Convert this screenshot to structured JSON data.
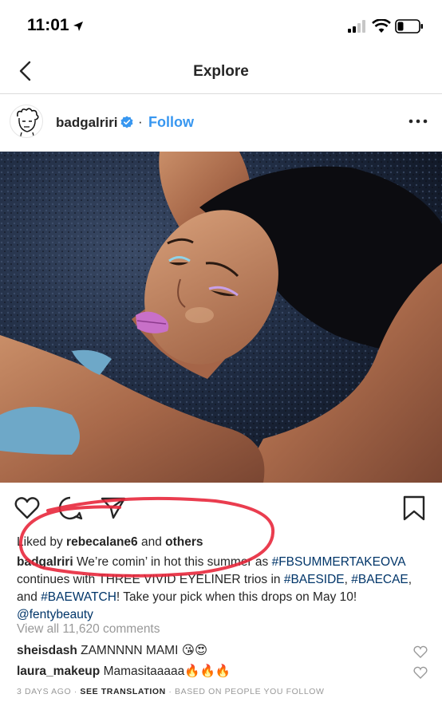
{
  "status_bar": {
    "time": "11:01",
    "icons": [
      "location-arrow-icon",
      "signal-icon",
      "wifi-icon",
      "battery-icon"
    ]
  },
  "nav": {
    "title": "Explore",
    "back_icon": "chevron-left-icon"
  },
  "post": {
    "username": "badgalriri",
    "verified": true,
    "dot": "·",
    "follow_label": "Follow",
    "more_icon": "ellipsis-icon",
    "photo_icon": "photo",
    "actions": [
      "heart-icon",
      "comment-icon",
      "share-icon",
      "bookmark-icon"
    ],
    "likes": {
      "prefix": "Liked by",
      "user": "rebecalane6",
      "conj": "and",
      "others": "others"
    },
    "caption": {
      "user": "badgalriri",
      "text1": "We’re comin’ in hot this summer as",
      "tag1": "#FBSUMMERTAKEOVA",
      "text2": "continues with THREE VIVID EYELINER trios in",
      "tag2": "#BAESIDE",
      "sep1": ",",
      "tag3": "#BAECAE",
      "sep2": ", and",
      "tag4": "#BAEWATCH",
      "text3": "! Take your pick when this drops on May 10!",
      "mention": "@fentybeauty"
    },
    "view_all_comments": "View all 11,620 comments",
    "comments": [
      {
        "user": "sheisdash",
        "text": "ZAMNNNN MAMI 😘😍"
      },
      {
        "user": "laura_makeup",
        "text": "Mamasitaaaaa🔥🔥🔥"
      }
    ],
    "meta": {
      "age": "3 DAYS AGO",
      "sep": "·",
      "see_translation": "SEE TRANSLATION",
      "sep2": "·",
      "based_on": "BASED ON PEOPLE YOU FOLLOW"
    }
  },
  "colors": {
    "link_blue": "#3897f0",
    "hashtag_blue": "#003569",
    "annotation_red": "#e8283c",
    "text": "#262626",
    "muted": "#999999"
  }
}
